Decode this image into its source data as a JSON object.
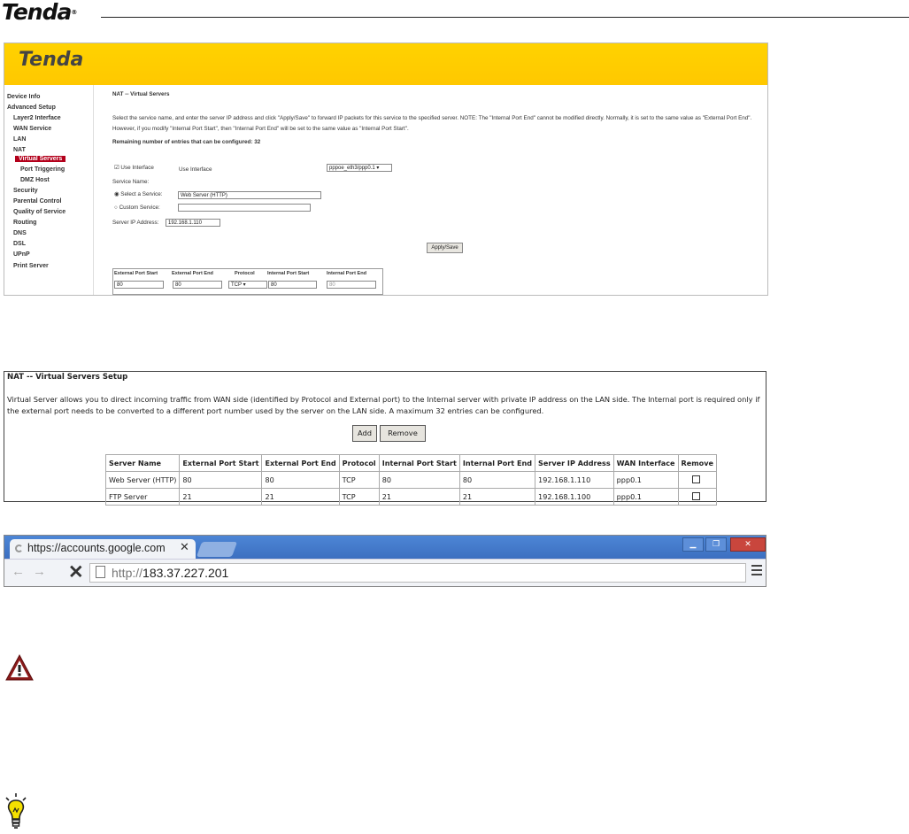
{
  "header": {
    "logo": "Tenda",
    "logo_mark": "®"
  },
  "router_ui": {
    "logo": "Tenda",
    "nav": [
      "Device Info",
      "Advanced Setup",
      "Layer2 Interface",
      "WAN Service",
      "LAN",
      "NAT",
      "Virtual Servers",
      "Port Triggering",
      "DMZ Host",
      "Security",
      "Parental Control",
      "Quality of Service",
      "Routing",
      "DNS",
      "DSL",
      "UPnP",
      "Print Server"
    ],
    "page_title": "NAT -- Virtual Servers",
    "instructions": "Select the service name, and enter the server IP address and click \"Apply/Save\" to forward IP packets for this service to the specified server. NOTE: The \"Internal Port End\" cannot be modified directly. Normally, it is set to the same value as \"External Port End\". However, if you modify \"Internal Port Start\", then \"Internal Port End\" will be set to the same value as \"Internal Port Start\".",
    "remaining": "Remaining number of entries that can be configured: 32",
    "use_interface_label": "Use Interface",
    "use_interface_value": "Use Interface",
    "interface_select": "pppoe_eth3/ppp0.1",
    "service_name_label": "Service Name:",
    "select_service_label": "Select a Service:",
    "select_service_value": "Web Server (HTTP)",
    "custom_service_label": "Custom Service:",
    "server_ip_label": "Server IP Address:",
    "server_ip_value": "192.168.1.110",
    "apply_button": "Apply/Save",
    "columns": [
      "External Port Start",
      "External Port End",
      "Protocol",
      "Internal Port Start",
      "Internal Port End"
    ],
    "row": [
      "80",
      "80",
      "TCP",
      "80",
      "80"
    ]
  },
  "nat_setup": {
    "title": "NAT -- Virtual Servers Setup",
    "description": "Virtual Server allows you to direct incoming traffic from WAN side (identified by Protocol and External port) to the Internal server with private IP address on the LAN side. The Internal port is required only if the external port needs to be converted to a different port number used by the server on the LAN side. A maximum 32 entries can be configured.",
    "add_button": "Add",
    "remove_button": "Remove",
    "columns": [
      "Server Name",
      "External Port Start",
      "External Port End",
      "Protocol",
      "Internal Port Start",
      "Internal Port End",
      "Server IP Address",
      "WAN Interface",
      "Remove"
    ],
    "rows": [
      [
        "Web Server (HTTP)",
        "80",
        "80",
        "TCP",
        "80",
        "80",
        "192.168.1.110",
        "ppp0.1"
      ],
      [
        "FTP Server",
        "21",
        "21",
        "TCP",
        "21",
        "21",
        "192.168.1.100",
        "ppp0.1"
      ]
    ]
  },
  "browser": {
    "tab_title": "https://accounts.google.com",
    "url_scheme": "http://",
    "url_host": "183.37.227.201"
  },
  "icons": {
    "warning": "warning-triangle-icon",
    "tip": "lightbulb-icon"
  },
  "colors": {
    "banner": "#ffc800",
    "active_nav": "#b3001b",
    "warning": "#8b1a1a",
    "tip": "#f5e000"
  }
}
